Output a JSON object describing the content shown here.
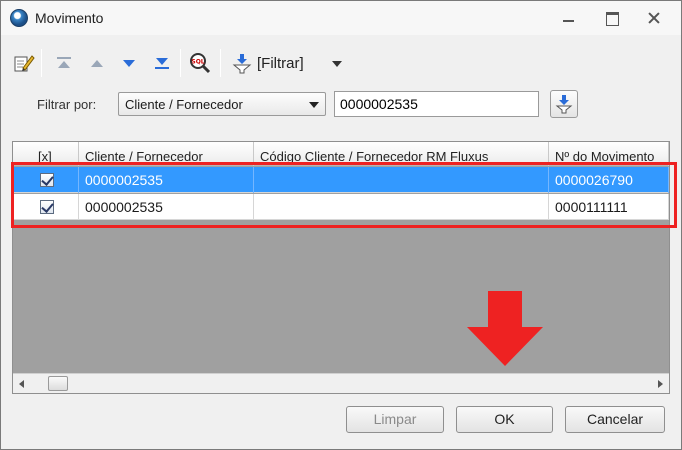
{
  "window": {
    "title": "Movimento"
  },
  "toolbar": {
    "filter_label": "[Filtrar]",
    "icons": [
      "edit-icon",
      "first-record-icon",
      "previous-record-icon",
      "next-record-icon",
      "last-record-icon",
      "sql-search-icon",
      "filter-icon",
      "dropdown-arrow-icon"
    ]
  },
  "filter": {
    "label": "Filtrar por:",
    "field_selected": "Cliente / Fornecedor",
    "value": "0000002535"
  },
  "grid": {
    "columns": [
      "[x]",
      "Cliente / Fornecedor",
      "Código Cliente / Fornecedor RM Fluxus",
      "Nº do Movimento"
    ],
    "rows": [
      {
        "checked": true,
        "selected": true,
        "cliente": "0000002535",
        "codigo": "",
        "movimento": "0000026790"
      },
      {
        "checked": true,
        "selected": false,
        "cliente": "0000002535",
        "codigo": "",
        "movimento": "0000111111"
      }
    ]
  },
  "buttons": {
    "limpar": "Limpar",
    "ok": "OK",
    "cancelar": "Cancelar"
  },
  "colors": {
    "selection": "#3399ff",
    "highlight": "#ee2222",
    "empty_grid": "#a0a0a0"
  }
}
